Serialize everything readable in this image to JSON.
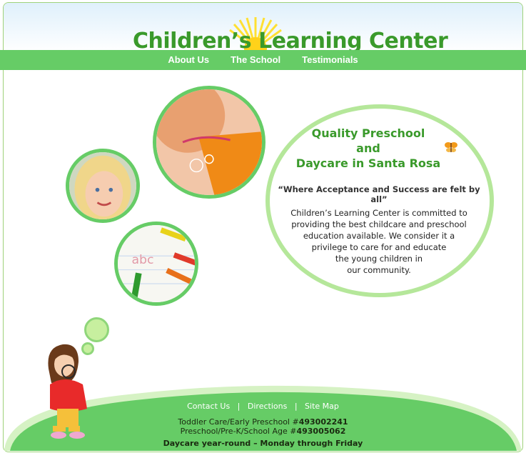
{
  "logo": {
    "text": "Children’s Learning Center"
  },
  "nav": {
    "items": [
      {
        "label": "About Us"
      },
      {
        "label": "The School"
      },
      {
        "label": "Testimonials"
      }
    ]
  },
  "main": {
    "headline_line1": "Quality Preschool",
    "headline_line2": "and",
    "headline_line3": "Daycare in Santa Rosa",
    "tagline": "“Where Acceptance and Success are felt by all”",
    "description_lines": [
      "Children’s Learning Center is committed to",
      "providing the best childcare and preschool",
      "education available. We consider it a",
      "privilege to care for and educate",
      "the young children in",
      "our community."
    ]
  },
  "footer": {
    "links": [
      {
        "label": "Contact Us"
      },
      {
        "label": "Directions"
      },
      {
        "label": "Site Map"
      }
    ],
    "separator": "|",
    "license1_label": "Toddler Care/Early Preschool #",
    "license1_number": "493002241",
    "license2_label": "Preschool/Pre-K/School Age #",
    "license2_number": "493005062",
    "hours": "Daycare year-round – Monday through Friday"
  },
  "colors": {
    "accent_green": "#66cc66",
    "logo_green": "#3a9a2b",
    "light_green": "#b5e79a"
  }
}
